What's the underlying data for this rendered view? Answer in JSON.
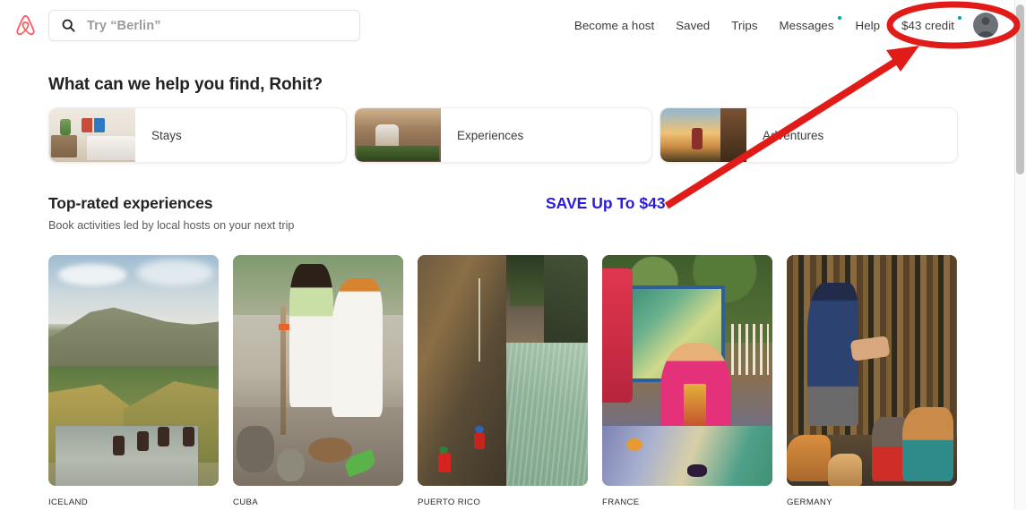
{
  "brand": {
    "name": "Airbnb",
    "logo_icon": "airbnb-belo-logo",
    "logo_color": "#FF5A5F"
  },
  "search": {
    "icon": "search-icon",
    "placeholder": "Try “Berlin”",
    "value": ""
  },
  "nav": {
    "items": [
      {
        "label": "Become a host",
        "dot": false
      },
      {
        "label": "Saved",
        "dot": false
      },
      {
        "label": "Trips",
        "dot": false
      },
      {
        "label": "Messages",
        "dot": true
      },
      {
        "label": "Help",
        "dot": false
      },
      {
        "label": "$43 credit",
        "dot": true
      }
    ],
    "dot_color": "#00A699",
    "avatar": "user-avatar"
  },
  "main": {
    "greeting": "What can we help you find, Rohit?",
    "categories": [
      {
        "label": "Stays",
        "thumb": "bedroom-photo"
      },
      {
        "label": "Experiences",
        "thumb": "cooking-class-photo"
      },
      {
        "label": "Adventures",
        "thumb": "hiking-sunrise-photo"
      }
    ],
    "section": {
      "title": "Top-rated experiences",
      "subtitle": "Book activities led by local hosts on your next trip"
    },
    "experiences": [
      {
        "caption": "ICELAND",
        "photo": "horseback-riding-river-valley"
      },
      {
        "caption": "CUBA",
        "photo": "santeria-ritual-courtyard"
      },
      {
        "caption": "PUERTO RICO",
        "photo": "canyon-river-rappelling"
      },
      {
        "caption": "FRANCE",
        "photo": "woman-at-decorated-table"
      },
      {
        "caption": "GERMANY",
        "photo": "man-with-dogs-in-forest"
      }
    ]
  },
  "annotations": {
    "save_text": "SAVE Up To $43",
    "save_text_color": "#2A1AE0",
    "highlight_color": "#E01B18",
    "ellipse_target": "$43 credit",
    "arrow": "arrow-pointing-to-credit"
  },
  "scrollbar": {
    "orientation": "vertical",
    "thumb_position": "top"
  }
}
